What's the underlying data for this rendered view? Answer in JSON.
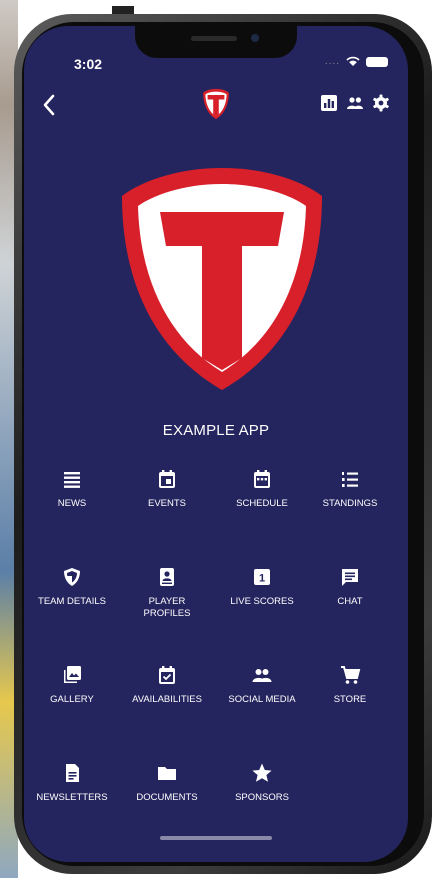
{
  "status_bar": {
    "time": "3:02",
    "signal": "...."
  },
  "header": {
    "back_icon": "chevron-left-icon",
    "logo": "team-shield-logo",
    "actions": [
      "stats-icon",
      "people-icon",
      "gear-icon"
    ]
  },
  "app": {
    "title": "EXAMPLE APP",
    "brand_color": "#d7202a",
    "background": "#24245e"
  },
  "menu": [
    {
      "label": "NEWS",
      "icon": "list-icon"
    },
    {
      "label": "EVENTS",
      "icon": "calendar-icon"
    },
    {
      "label": "SCHEDULE",
      "icon": "calendar-grid-icon"
    },
    {
      "label": "STANDINGS",
      "icon": "numbered-list-icon"
    },
    {
      "label": "TEAM DETAILS",
      "icon": "shield-icon"
    },
    {
      "label": "PLAYER PROFILES",
      "icon": "player-badge-icon"
    },
    {
      "label": "LIVE SCORES",
      "icon": "scoreboard-icon"
    },
    {
      "label": "CHAT",
      "icon": "chat-icon"
    },
    {
      "label": "GALLERY",
      "icon": "photo-gallery-icon"
    },
    {
      "label": "AVAILABILITIES",
      "icon": "calendar-check-icon"
    },
    {
      "label": "SOCIAL MEDIA",
      "icon": "people-icon"
    },
    {
      "label": "STORE",
      "icon": "cart-icon"
    },
    {
      "label": "NEWSLETTERS",
      "icon": "document-icon"
    },
    {
      "label": "DOCUMENTS",
      "icon": "folder-icon"
    },
    {
      "label": "SPONSORS",
      "icon": "star-icon"
    }
  ]
}
